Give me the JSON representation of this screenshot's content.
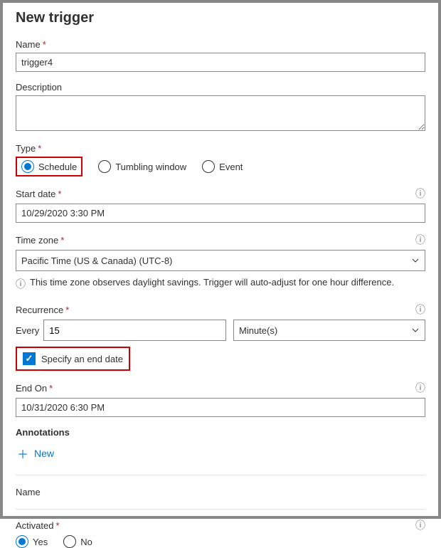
{
  "title": "New trigger",
  "name": {
    "label": "Name",
    "value": "trigger4"
  },
  "description": {
    "label": "Description",
    "value": ""
  },
  "type": {
    "label": "Type",
    "options": {
      "schedule": "Schedule",
      "tumbling": "Tumbling window",
      "event": "Event"
    },
    "selected": "schedule"
  },
  "startDate": {
    "label": "Start date",
    "value": "10/29/2020 3:30 PM"
  },
  "timezone": {
    "label": "Time zone",
    "value": "Pacific Time (US & Canada) (UTC-8)",
    "note": "This time zone observes daylight savings. Trigger will auto-adjust for one hour difference."
  },
  "recurrence": {
    "label": "Recurrence",
    "everyLabel": "Every",
    "everyValue": "15",
    "unit": "Minute(s)"
  },
  "specifyEnd": {
    "label": "Specify an end date",
    "checked": true
  },
  "endOn": {
    "label": "End On",
    "value": "10/31/2020 6:30 PM"
  },
  "annotations": {
    "label": "Annotations",
    "newLabel": "New",
    "columnHeader": "Name"
  },
  "activated": {
    "label": "Activated",
    "options": {
      "yes": "Yes",
      "no": "No"
    },
    "selected": "yes"
  }
}
